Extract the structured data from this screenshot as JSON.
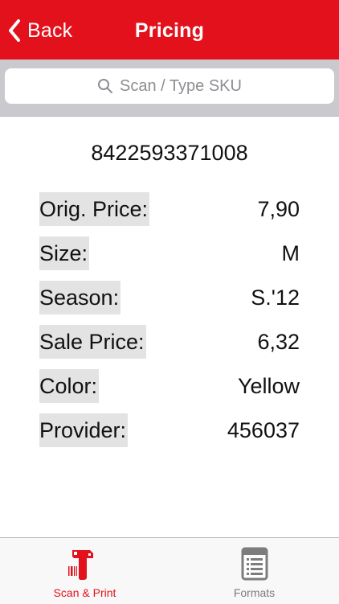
{
  "nav": {
    "back_label": "Back",
    "title": "Pricing"
  },
  "search": {
    "placeholder": "Scan / Type SKU"
  },
  "product": {
    "sku": "8422593371008",
    "fields": [
      {
        "label": "Orig. Price:",
        "value": "7,90"
      },
      {
        "label": "Size:",
        "value": "M"
      },
      {
        "label": "Season:",
        "value": "S.'12"
      },
      {
        "label": "Sale Price:",
        "value": "6,32"
      },
      {
        "label": "Color:",
        "value": "Yellow"
      },
      {
        "label": "Provider:",
        "value": "456037"
      }
    ]
  },
  "tabbar": {
    "tabs": [
      {
        "label": "Scan & Print",
        "icon": "barcode-scanner-icon",
        "active": true
      },
      {
        "label": "Formats",
        "icon": "formats-list-icon",
        "active": false
      }
    ]
  },
  "colors": {
    "accent": "#e3111b",
    "label_highlight": "#e3e3e3",
    "search_bar_bg": "#c9c9ce"
  }
}
